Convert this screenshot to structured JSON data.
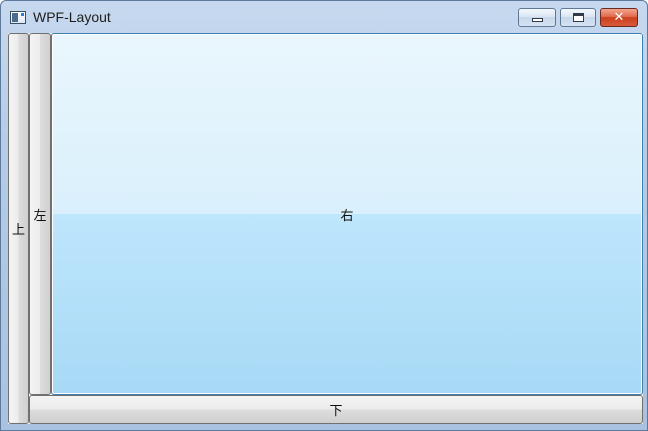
{
  "window": {
    "title": "WPF-Layout",
    "icon": "app-window-icon",
    "caption_buttons": {
      "minimize_icon": "minimize-icon",
      "maximize_icon": "maximize-icon",
      "close_icon": "close-icon",
      "close_glyph": "✕"
    }
  },
  "buttons": {
    "top": "上",
    "left": "左",
    "right": "右",
    "bottom": "下"
  },
  "colors": {
    "frame": "#b5cbe6",
    "client_bg": "#f0f0f0",
    "hover_fill": "#bee6fd",
    "hover_border": "#3c7fb1",
    "close": "#c9401f"
  }
}
